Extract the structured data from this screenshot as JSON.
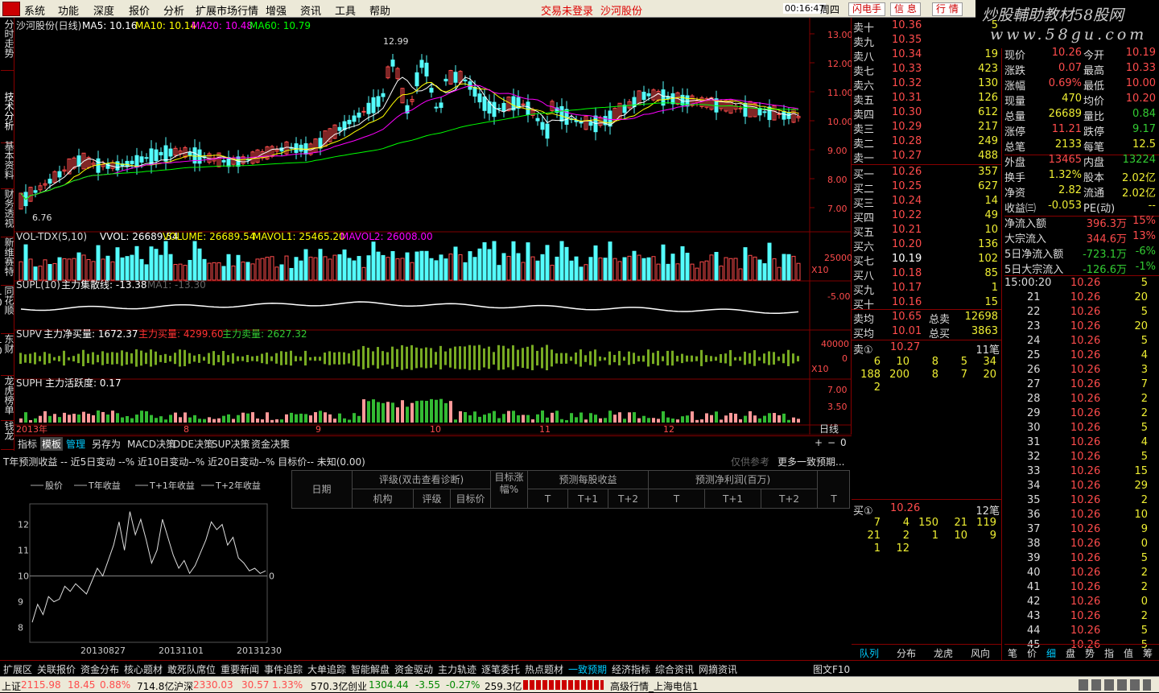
{
  "menu": {
    "items": [
      "系统",
      "功能",
      "深度",
      "报价",
      "分析",
      "扩展市场行情",
      "增强",
      "资讯",
      "工具",
      "帮助"
    ],
    "login_status": "交易未登录",
    "stock_name": "沙河股份",
    "clock": "00:16:47",
    "weekday": "周四",
    "buttons": [
      "闪电手",
      "信 息",
      "行 情"
    ]
  },
  "brand": {
    "line1": "炒股輔助教材58股网",
    "line2": "www.58gu.com"
  },
  "left_tabs": [
    "分时走势",
    "技术分析",
    "基本资料",
    "财务透视",
    "新维赛特",
    "同花顺10",
    "东财10",
    "龙虎榜单",
    "钱龙"
  ],
  "chart_header": {
    "title": "沙河股份(日线)",
    "ma5": "MA5: 10.16",
    "ma10": "MA10: 10.14",
    "ma20": "MA20: 10.48",
    "ma60": "MA60: 10.79"
  },
  "vol_header": {
    "name": "VOL-TDX(5,10)",
    "vvol": "VVOL: 26689.54",
    "volume": "VOLUME: 26689.54",
    "mavol1": "MAVOL1: 25465.20",
    "mavol2": "MAVOL2: 26008.00"
  },
  "supl_header": {
    "name": "SUPL(10)",
    "desc": "主力集散线: -13.38",
    "ma1": "MA1: -13.30"
  },
  "supv_header": {
    "name": "SUPV",
    "net": "主力净买量: 1672.37",
    "buy": "主力买量: 4299.60",
    "sell": "主力卖量: 2627.32"
  },
  "suph_header": {
    "name": "SUPH",
    "desc": "主力活跃度: 0.17"
  },
  "period_label": "日线",
  "price_axis": [
    "13.00",
    "12.00",
    "11.00",
    "10.00",
    "9.00",
    "8.00",
    "7.00"
  ],
  "vol_axis": [
    "25000",
    "X10"
  ],
  "supl_axis": [
    "-5.00"
  ],
  "supv_axis": [
    "40000",
    "0",
    "X10"
  ],
  "suph_axis": [
    "7.00",
    "3.50"
  ],
  "x_axis": [
    "2013年",
    "8",
    "9",
    "10",
    "11",
    "12"
  ],
  "annotations": {
    "high": "12.99",
    "low": "6.76"
  },
  "indicator_tabs": [
    "指标",
    "模板",
    "管理",
    "另存为",
    "MACD决策",
    "DDE决策",
    "SUP决策",
    "资金决策"
  ],
  "small_ctrl": [
    "+",
    "−",
    "0"
  ],
  "forecast": {
    "text": "T年预测收益 --  近5日变动 --%  近10日变动--%  近20日变动--%  目标价-- 未知(0.00)",
    "ref": "仅供参考",
    "more": "更多一致预期..."
  },
  "forecast_legend": [
    "股价",
    "T年收益",
    "T+1年收益",
    "T+2年收益"
  ],
  "forecast_chart": {
    "type": "line",
    "y_ticks": [
      "12",
      "11",
      "10",
      "9",
      "8"
    ],
    "x_ticks": [
      "20130827",
      "20131101",
      "20131230"
    ],
    "right_label": "0",
    "values": [
      8.2,
      8.9,
      8.5,
      9.2,
      9.0,
      9.1,
      9.6,
      9.4,
      9.7,
      9.5,
      9.3,
      9.8,
      10.3,
      10.0,
      10.6,
      11.2,
      12.1,
      11.0,
      12.5,
      11.6,
      12.2,
      11.4,
      10.5,
      11.0,
      12.2,
      11.5,
      10.8,
      10.3,
      10.6,
      10.1,
      10.4,
      10.9,
      11.4,
      12.1,
      11.8,
      12.0,
      11.2,
      11.5,
      10.7,
      10.5,
      10.2,
      10.3,
      10.1,
      10.2
    ]
  },
  "rating_table": {
    "col_date": "日期",
    "col_rating": "评级(双击查看诊断)",
    "col_target": "目标涨幅%",
    "col_eps": "预测每股收益",
    "col_profit": "预测净利润(百万)",
    "sub": [
      "机构",
      "评级",
      "目标价",
      "T",
      "T+1",
      "T+2",
      "T",
      "T+1",
      "T+2",
      "T"
    ]
  },
  "order_book": {
    "sell": [
      {
        "l": "卖十",
        "p": "10.36",
        "v": "5"
      },
      {
        "l": "卖九",
        "p": "10.35",
        "v": ""
      },
      {
        "l": "卖八",
        "p": "10.34",
        "v": "19"
      },
      {
        "l": "卖七",
        "p": "10.33",
        "v": "423"
      },
      {
        "l": "卖六",
        "p": "10.32",
        "v": "130"
      },
      {
        "l": "卖五",
        "p": "10.31",
        "v": "126"
      },
      {
        "l": "卖四",
        "p": "10.30",
        "v": "612"
      },
      {
        "l": "卖三",
        "p": "10.29",
        "v": "217"
      },
      {
        "l": "卖二",
        "p": "10.28",
        "v": "249"
      },
      {
        "l": "卖一",
        "p": "10.27",
        "v": "488"
      }
    ],
    "buy": [
      {
        "l": "买一",
        "p": "10.26",
        "v": "357"
      },
      {
        "l": "买二",
        "p": "10.25",
        "v": "627"
      },
      {
        "l": "买三",
        "p": "10.24",
        "v": "14"
      },
      {
        "l": "买四",
        "p": "10.22",
        "v": "49"
      },
      {
        "l": "买五",
        "p": "10.21",
        "v": "10"
      },
      {
        "l": "买六",
        "p": "10.20",
        "v": "136"
      },
      {
        "l": "买七",
        "p": "10.19",
        "v": "102"
      },
      {
        "l": "买八",
        "p": "10.18",
        "v": "85"
      },
      {
        "l": "买九",
        "p": "10.17",
        "v": "1"
      },
      {
        "l": "买十",
        "p": "10.16",
        "v": "15"
      }
    ],
    "avg": [
      {
        "l": "卖均",
        "p": "10.65",
        "k": "总卖",
        "v": "12698"
      },
      {
        "l": "买均",
        "p": "10.01",
        "k": "总买",
        "v": "3863"
      }
    ],
    "sell1_queue": {
      "label": "卖①",
      "price": "10.27",
      "count": "11笔",
      "rows": [
        [
          "6",
          "10",
          "8",
          "5",
          "34"
        ],
        [
          "188",
          "200",
          "8",
          "7",
          "20"
        ],
        [
          "2",
          "",
          "",
          "",
          ""
        ]
      ]
    },
    "buy1_queue": {
      "label": "买①",
      "price": "10.26",
      "count": "12笔",
      "rows": [
        [
          "7",
          "4",
          "150",
          "21",
          "119"
        ],
        [
          "21",
          "2",
          "1",
          "10",
          "9"
        ],
        [
          "1",
          "12",
          "",
          "",
          ""
        ]
      ]
    }
  },
  "quote": [
    [
      "现价",
      "10.26",
      "今开",
      "10.19"
    ],
    [
      "涨跌",
      "0.07",
      "最高",
      "10.33"
    ],
    [
      "涨幅",
      "0.69%",
      "最低",
      "10.00"
    ],
    [
      "现量",
      "470",
      "均价",
      "10.20"
    ],
    [
      "总量",
      "26689",
      "量比",
      "0.84"
    ],
    [
      "涨停",
      "11.21",
      "跌停",
      "9.17"
    ],
    [
      "总笔",
      "2133",
      "每笔",
      "12.5"
    ],
    [
      "外盘",
      "13465",
      "内盘",
      "13224"
    ],
    [
      "换手",
      "1.32%",
      "股本",
      "2.02亿"
    ],
    [
      "净资",
      "2.82",
      "流通",
      "2.02亿"
    ],
    [
      "收益㈢",
      "-0.053",
      "PE(动)",
      "--"
    ],
    [
      "净流入额",
      "396.3万",
      "",
      "15%"
    ],
    [
      "大宗流入",
      "344.6万",
      "",
      "13%"
    ],
    [
      "5日净流入额",
      "-723.1万",
      "",
      "-6%"
    ],
    [
      "5日大宗流入",
      "-126.6万",
      "",
      "-1%"
    ]
  ],
  "ticks": [
    [
      "15:00:20",
      "10.26",
      "5"
    ],
    [
      "21",
      "10.26",
      "20"
    ],
    [
      "22",
      "10.26",
      "5"
    ],
    [
      "23",
      "10.26",
      "20"
    ],
    [
      "24",
      "10.26",
      "5"
    ],
    [
      "25",
      "10.26",
      "4"
    ],
    [
      "26",
      "10.26",
      "3"
    ],
    [
      "27",
      "10.26",
      "7"
    ],
    [
      "28",
      "10.26",
      "2"
    ],
    [
      "29",
      "10.26",
      "2"
    ],
    [
      "30",
      "10.26",
      "5"
    ],
    [
      "31",
      "10.26",
      "4"
    ],
    [
      "32",
      "10.26",
      "5"
    ],
    [
      "33",
      "10.26",
      "15"
    ],
    [
      "34",
      "10.26",
      "29"
    ],
    [
      "35",
      "10.26",
      "2"
    ],
    [
      "36",
      "10.26",
      "10"
    ],
    [
      "37",
      "10.26",
      "9"
    ],
    [
      "38",
      "10.26",
      "0"
    ],
    [
      "39",
      "10.26",
      "5"
    ],
    [
      "40",
      "10.26",
      "2"
    ],
    [
      "41",
      "10.26",
      "2"
    ],
    [
      "42",
      "10.26",
      "0"
    ],
    [
      "43",
      "10.26",
      "2"
    ],
    [
      "44",
      "10.26",
      "5"
    ],
    [
      "45",
      "10.26",
      "5"
    ]
  ],
  "right_tabs_bottom": [
    "队列",
    "分布",
    "龙虎",
    "风向"
  ],
  "right_tabs_small": [
    "笔",
    "价",
    "细",
    "盘",
    "势",
    "指",
    "值",
    "筹"
  ],
  "bottom_tabs": [
    "扩展区",
    "关联报价",
    "资金分布",
    "核心题材",
    "敢死队席位",
    "重要新闻",
    "事件追踪",
    "大单追踪",
    "智能解盘",
    "资金驱动",
    "主力轨迹",
    "逐笔委托",
    "热点题材",
    "一致预期",
    "经济指标",
    "综合资讯",
    "网摘资讯",
    "图文F10"
  ],
  "status": {
    "sh_label": "上证",
    "sh_val": "2115.98",
    "sh_chg": "18.45",
    "sh_pct": "0.88%",
    "sh_amt": "714.8亿",
    "hs_label": "沪深",
    "hs_val": "2330.03",
    "hs_chg": "30.57",
    "hs_pct": "1.33%",
    "hs_amt": "570.3亿",
    "cy_label": "创业",
    "cy_val": "1304.44",
    "cy_chg": "-3.55",
    "cy_pct": "-0.27%",
    "cy_amt": "259.3亿",
    "feed": "高级行情_上海电信1"
  },
  "colors": {
    "up": "#ff4c4c",
    "down": "#54fcfc",
    "ma5": "#ffffff",
    "ma10": "#ffff00",
    "ma20": "#ff00ff",
    "ma60": "#00ff00",
    "panel_border": "#800000"
  }
}
